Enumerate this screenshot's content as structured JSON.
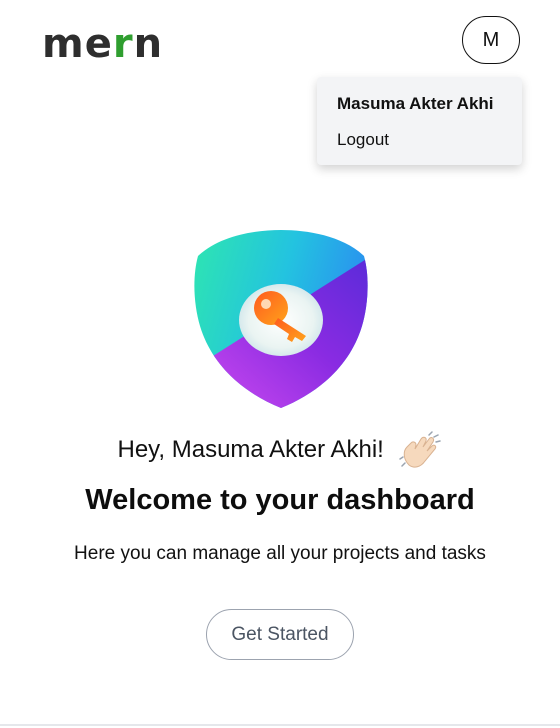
{
  "header": {
    "logo": {
      "letters": [
        "m",
        "e",
        "r",
        "n"
      ],
      "colors": [
        "#2e2e2e",
        "#2e2e2e",
        "#2f9e2f",
        "#2e2e2e"
      ]
    },
    "avatar_initial": "M"
  },
  "user_menu": {
    "name": "Masuma Akter Akhi",
    "logout_label": "Logout"
  },
  "main": {
    "illustration_icon": "shield-key-icon",
    "greeting": "Hey, Masuma Akter Akhi!",
    "greeting_icon": "waving-hand-icon",
    "headline": "Welcome to your dashboard",
    "subtitle": "Here you can manage all your projects and tasks",
    "cta_label": "Get Started"
  }
}
